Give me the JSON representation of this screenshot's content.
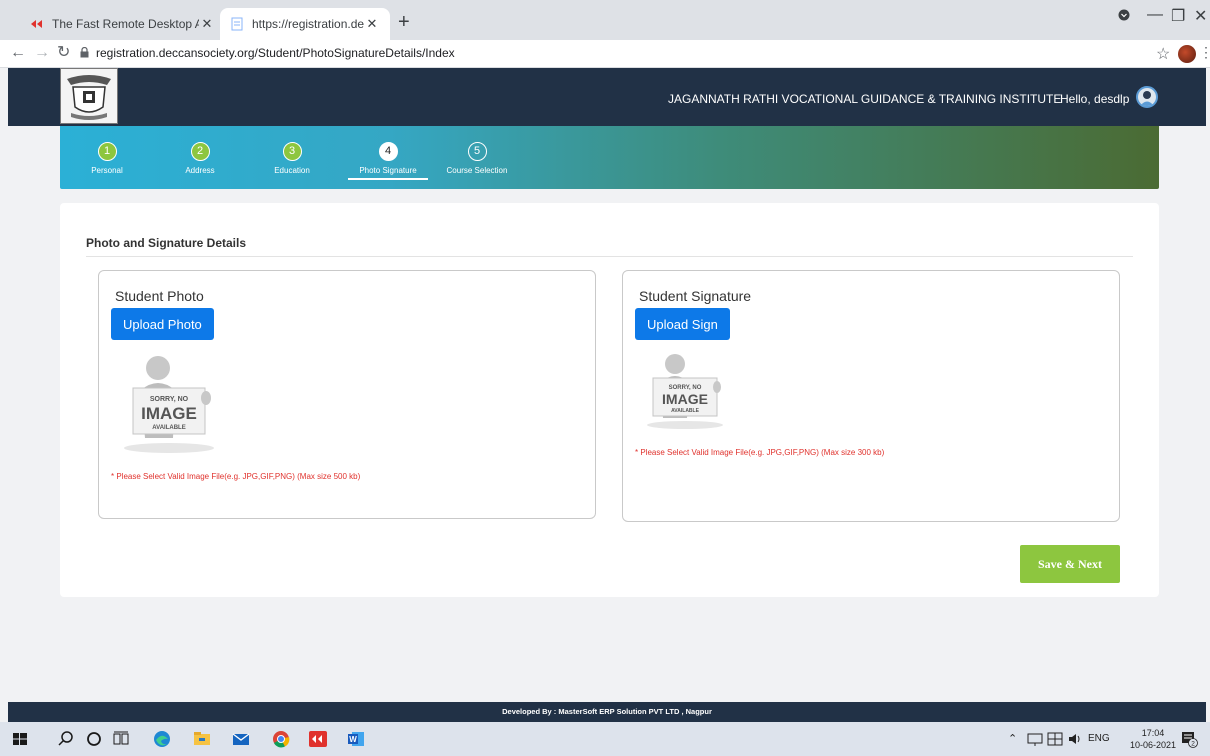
{
  "browser": {
    "tabs": [
      {
        "title": "The Fast Remote Desktop Applica"
      },
      {
        "title": "https://registration.deccansociety"
      }
    ],
    "new_tab": "+",
    "url": "registration.deccansociety.org/Student/PhotoSignatureDetails/Index"
  },
  "header": {
    "institute": "JAGANNATH RATHI VOCATIONAL GUIDANCE & TRAINING INSTITUTE",
    "greeting": "Hello, desdlp"
  },
  "steps": [
    {
      "number": "1",
      "label": "Personal",
      "state": "done"
    },
    {
      "number": "2",
      "label": "Address",
      "state": "done"
    },
    {
      "number": "3",
      "label": "Education",
      "state": "done"
    },
    {
      "number": "4",
      "label": "Photo Signature",
      "state": "current"
    },
    {
      "number": "5",
      "label": "Course Selection",
      "state": "todo"
    }
  ],
  "section": {
    "title": "Photo and Signature Details"
  },
  "photo": {
    "title": "Student Photo",
    "button": "Upload Photo",
    "placeholder": {
      "line1": "SORRY, NO",
      "line2": "IMAGE",
      "line3": "AVAILABLE"
    },
    "note": "* Please Select Valid Image File(e.g. JPG,GIF,PNG) (Max size 500 kb)"
  },
  "signature": {
    "title": "Student Signature",
    "button": "Upload Sign",
    "placeholder": {
      "line1": "SORRY, NO",
      "line2": "IMAGE",
      "line3": "AVAILABLE"
    },
    "note": "* Please Select Valid Image File(e.g. JPG,GIF,PNG) (Max size 300 kb)"
  },
  "actions": {
    "save_next": "Save & Next"
  },
  "footer": {
    "text": "Developed By : MasterSoft ERP Solution PVT LTD , Nagpur"
  },
  "taskbar": {
    "language": "ENG",
    "time": "17:04",
    "date": "10-06-2021",
    "notification_count": "2"
  },
  "colors": {
    "header": "#213146",
    "primary_button": "#0d79e8",
    "save_button": "#8dc63f",
    "error_text": "#e0322d"
  }
}
